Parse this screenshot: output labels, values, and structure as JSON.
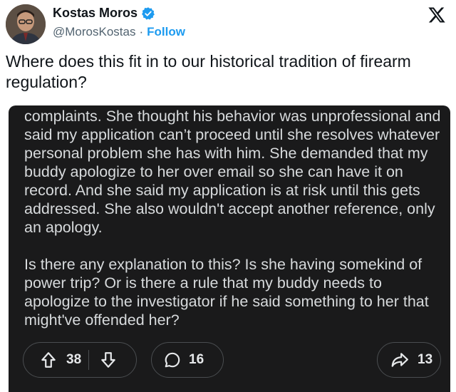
{
  "author": {
    "display_name": "Kostas Moros",
    "handle": "@MorosKostas",
    "separator": "·",
    "follow_label": "Follow"
  },
  "tweet": {
    "text": "Where does this fit in to our historical tradition of firearm regulation?"
  },
  "card": {
    "paragraph_1": "complaints. She thought his behavior was unprofessional and said my application can’t proceed until she resolves whatever personal problem she has with him. She demanded that my buddy apologize to her over email so she can have it on record. And she said my application is at risk until this gets addressed. She also wouldn't accept another reference, only an apology.",
    "paragraph_2": "Is there any explanation to this? Is she having somekind of power trip? Or is there a rule that my buddy needs to apologize to the investigator if he said something to her that might've offended her?",
    "upvotes": "38",
    "comments": "16",
    "shares": "13"
  },
  "colors": {
    "verified_badge": "#1d9bf0",
    "follow_link": "#1d9bf0",
    "card_background": "#1a1a1b"
  },
  "icons": {
    "logo": "x-logo-icon",
    "upvote": "arrow-up-icon",
    "downvote": "arrow-down-icon",
    "comment": "speech-bubble-icon",
    "share": "share-arrow-icon"
  }
}
